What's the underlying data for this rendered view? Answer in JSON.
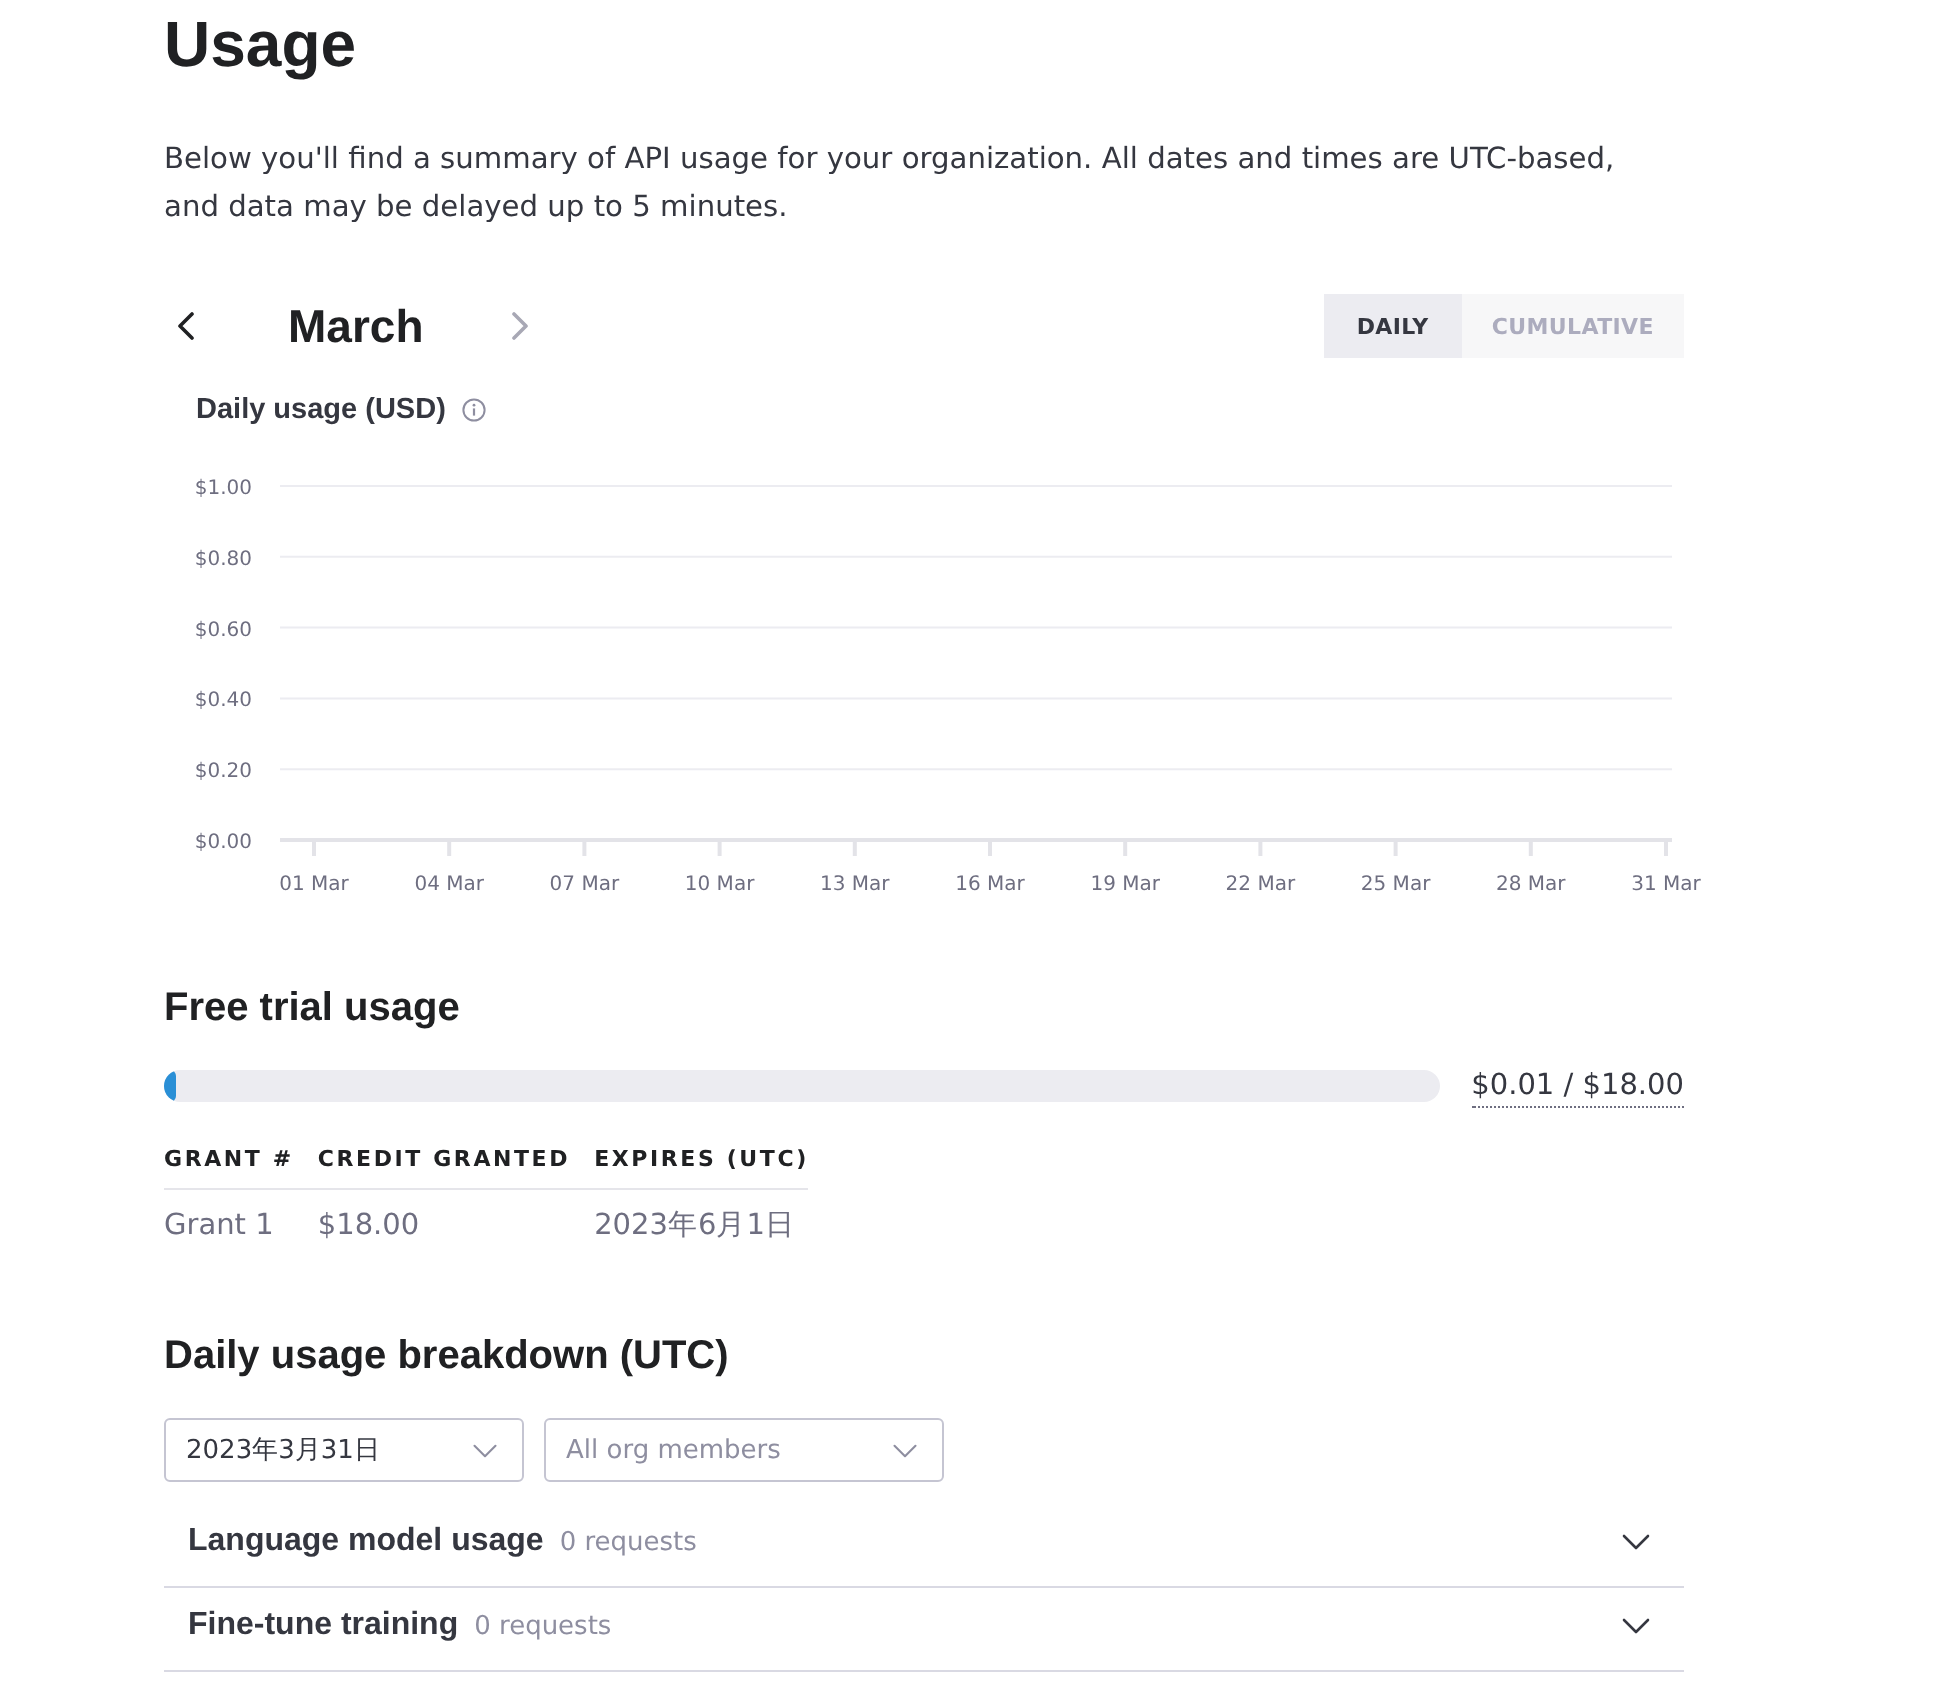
{
  "page": {
    "title": "Usage",
    "description": "Below you'll find a summary of API usage for your organization. All dates and times are UTC-based, and data may be delayed up to 5 minutes."
  },
  "month_nav": {
    "month": "March",
    "prev_button": {
      "disabled": false
    },
    "next_button": {
      "disabled": true
    }
  },
  "view_toggle": [
    {
      "label": "DAILY",
      "selected": true
    },
    {
      "label": "CUMULATIVE",
      "selected": false
    }
  ],
  "chart": {
    "chart_data": {
      "type": "bar",
      "title": "Daily usage (USD)",
      "grid": true,
      "categories": [
        "01 Mar",
        null,
        null,
        "04 Mar",
        null,
        null,
        "07 Mar",
        null,
        null,
        "10 Mar",
        null,
        null,
        "13 Mar",
        null,
        null,
        "16 Mar",
        null,
        null,
        "19 Mar",
        null,
        null,
        "22 Mar",
        null,
        null,
        "25 Mar",
        null,
        null,
        "28 Mar",
        null,
        null,
        "31 Mar"
      ],
      "ylim": [
        0,
        1
      ],
      "yticks": [
        {
          "value": 0,
          "label": "$0.00"
        },
        {
          "value": 0.2,
          "label": "$0.20"
        },
        {
          "value": 0.4,
          "label": "$0.40"
        },
        {
          "value": 0.6,
          "label": "$0.60"
        },
        {
          "value": 0.8,
          "label": "$0.80"
        },
        {
          "value": 1,
          "label": "$1.00"
        }
      ]
    }
  },
  "free_trial": {
    "title": "Free trial usage",
    "level": 0.009,
    "reading": "$0.01 / $18.00",
    "columns": [
      "GRANT #",
      "CREDIT GRANTED",
      "EXPIRES (UTC)"
    ],
    "rows": [
      [
        "Grant 1",
        "$18.00",
        "2023年6月1日"
      ]
    ]
  },
  "breakdown": {
    "title": "Daily usage breakdown (UTC)",
    "date_select": {
      "value": "2023年3月31日"
    },
    "member_select": {
      "placeholder": "All org members"
    },
    "sections": [
      {
        "label": "Language model usage",
        "count": "0 requests",
        "expanded": false
      },
      {
        "label": "Fine-tune training",
        "count": "0 requests",
        "expanded": false
      }
    ]
  }
}
